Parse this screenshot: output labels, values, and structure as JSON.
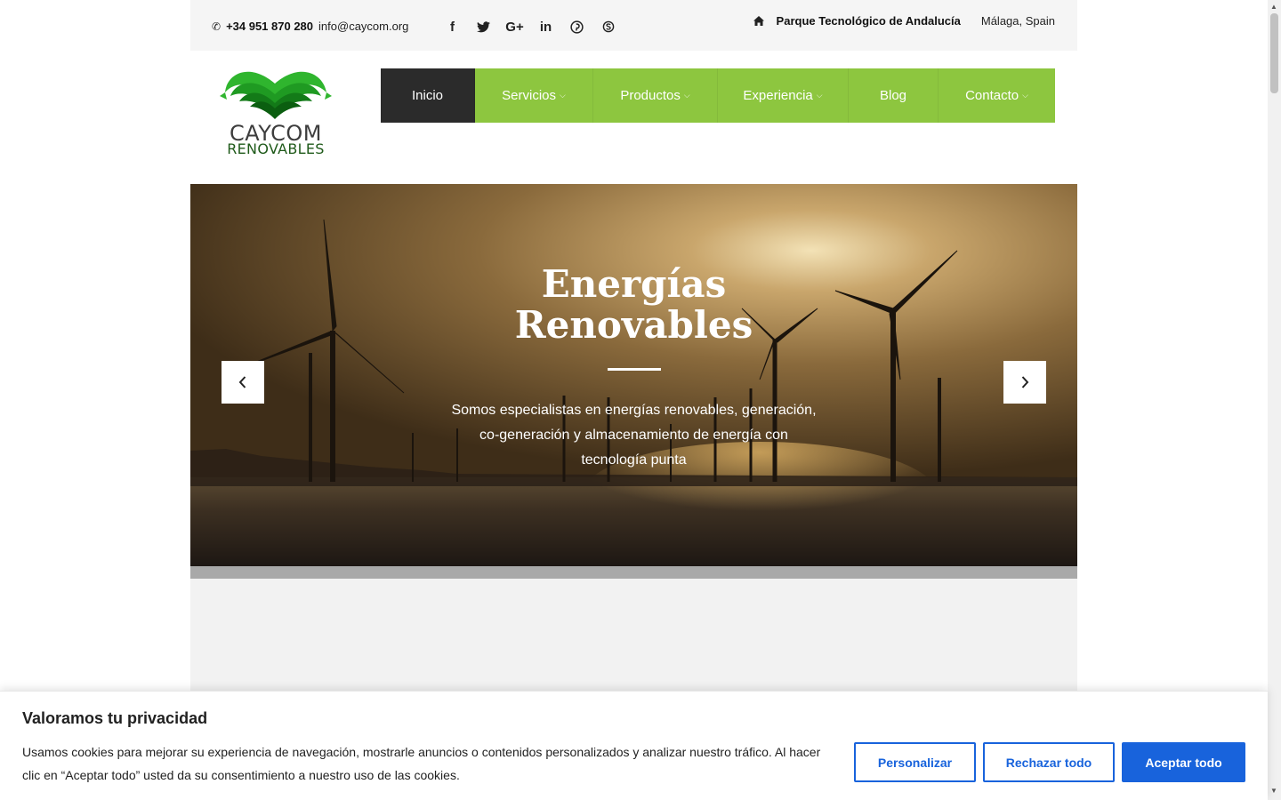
{
  "topbar": {
    "phone": "+34 951 870 280",
    "email": "info@caycom.org",
    "socials": [
      {
        "name": "facebook-icon",
        "glyph": "f"
      },
      {
        "name": "twitter-icon",
        "glyph": "🐦"
      },
      {
        "name": "google-plus-icon",
        "glyph": "G+"
      },
      {
        "name": "linkedin-icon",
        "glyph": "in"
      },
      {
        "name": "pinterest-icon",
        "glyph": "℗"
      },
      {
        "name": "skype-icon",
        "glyph": "S"
      }
    ],
    "address_name": "Parque Tecnológico de Andalucía",
    "address_city": "Málaga, Spain"
  },
  "logo": {
    "line1": "CAYCOM",
    "line2": "RENOVABLES"
  },
  "nav": {
    "items": [
      {
        "label": "Inicio",
        "has_dropdown": false,
        "active": true
      },
      {
        "label": "Servicios",
        "has_dropdown": true,
        "active": false
      },
      {
        "label": "Productos",
        "has_dropdown": true,
        "active": false
      },
      {
        "label": "Experiencia",
        "has_dropdown": true,
        "active": false
      },
      {
        "label": "Blog",
        "has_dropdown": false,
        "active": false
      },
      {
        "label": "Contacto",
        "has_dropdown": true,
        "active": false
      }
    ]
  },
  "hero": {
    "title_line1": "Energías",
    "title_line2": "Renovables",
    "description": "Somos especialistas en energías renovables, generación, co-generación y almacenamiento de energía con tecnología punta",
    "prev_icon": "chevron-left-icon",
    "next_icon": "chevron-right-icon"
  },
  "cookie": {
    "title": "Valoramos tu privacidad",
    "text": "Usamos cookies para mejorar su experiencia de navegación, mostrarle anuncios o contenidos personalizados y analizar nuestro tráfico. Al hacer clic en “Aceptar todo” usted da su consentimiento a nuestro uso de las cookies.",
    "customize_label": "Personalizar",
    "reject_label": "Rechazar todo",
    "accept_label": "Aceptar todo"
  },
  "colors": {
    "nav_green": "#8dc63f",
    "nav_active": "#2b2b2b",
    "cookie_blue": "#1863dc",
    "topbar_bg": "#f5f5f5"
  }
}
